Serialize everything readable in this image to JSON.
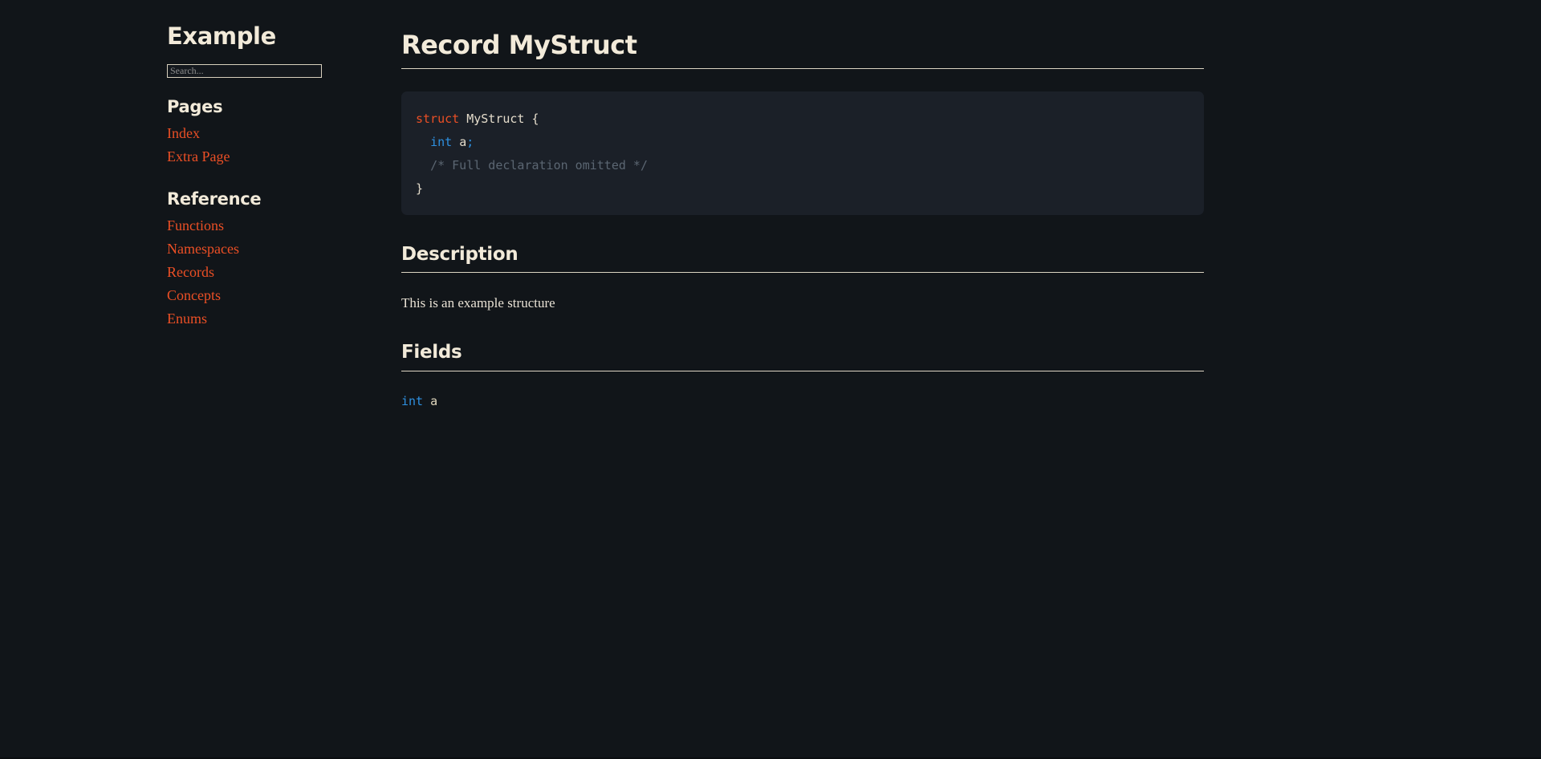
{
  "theme": {
    "page_bg": "#111519",
    "code_bg": "#1b2028",
    "text": "#e8e1d4",
    "heading": "#f2ead9",
    "link": "#eb4f25",
    "rule": "#ddd5c3",
    "type_blue": "#2e90e0",
    "comment_gray": "#5b6672"
  },
  "sidebar": {
    "site_title": "Example",
    "search": {
      "placeholder": "Search...",
      "value": ""
    },
    "groups": [
      {
        "heading": "Pages",
        "items": [
          {
            "label": "Index"
          },
          {
            "label": "Extra Page"
          }
        ]
      },
      {
        "heading": "Reference",
        "items": [
          {
            "label": "Functions"
          },
          {
            "label": "Namespaces"
          },
          {
            "label": "Records"
          },
          {
            "label": "Concepts"
          },
          {
            "label": "Enums"
          }
        ]
      }
    ]
  },
  "main": {
    "title": "Record MyStruct",
    "code": {
      "lines": [
        [
          {
            "t": "struct",
            "c": "tok-keyword"
          },
          {
            "t": " ",
            "c": "tok-punct"
          },
          {
            "t": "MyStruct",
            "c": "tok-name"
          },
          {
            "t": " {",
            "c": "tok-punct"
          }
        ],
        [
          {
            "t": "  ",
            "c": "tok-punct"
          },
          {
            "t": "int",
            "c": "tok-type"
          },
          {
            "t": " ",
            "c": "tok-punct"
          },
          {
            "t": "a",
            "c": "tok-name"
          },
          {
            "t": ";",
            "c": "tok-op"
          }
        ],
        [
          {
            "t": "  ",
            "c": "tok-punct"
          },
          {
            "t": "/* Full declaration omitted */",
            "c": "tok-comment"
          }
        ],
        [
          {
            "t": "}",
            "c": "tok-punct"
          }
        ]
      ]
    },
    "sections": [
      {
        "heading": "Description",
        "kind": "text",
        "text": "This is an example structure"
      },
      {
        "heading": "Fields",
        "kind": "fields",
        "fields": [
          {
            "type": "int",
            "name": "a"
          }
        ]
      }
    ]
  }
}
